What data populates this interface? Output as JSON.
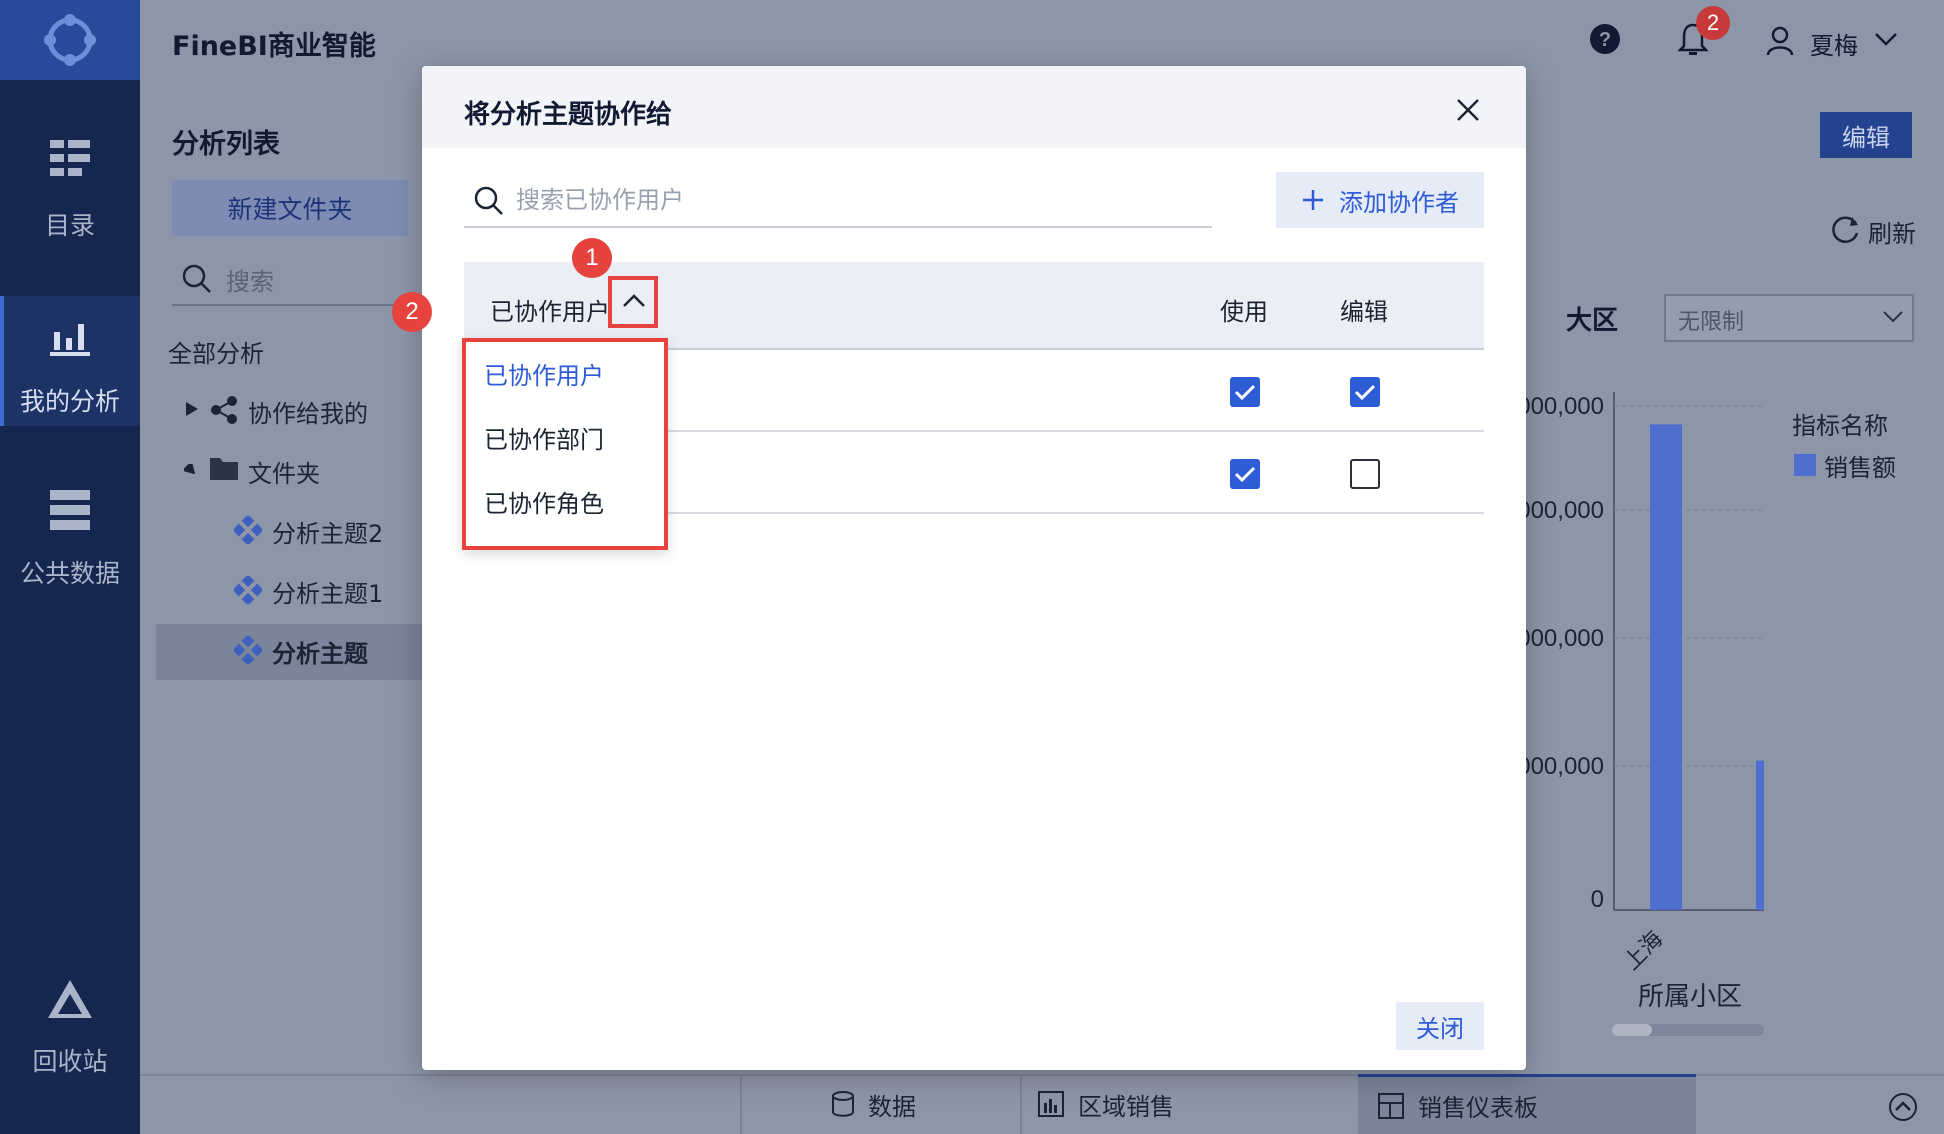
{
  "app": {
    "title": "FineBI商业智能",
    "user_name": "夏梅",
    "notification_count": "2"
  },
  "nav": [
    {
      "label": "目录",
      "icon": "catalog-icon"
    },
    {
      "label": "我的分析",
      "icon": "analysis-icon"
    },
    {
      "label": "公共数据",
      "icon": "public-data-icon"
    },
    {
      "label": "回收站",
      "icon": "recycle-icon"
    }
  ],
  "list": {
    "title": "分析列表",
    "new_folder": "新建文件夹",
    "search_placeholder": "搜索",
    "tree": [
      "全部分析",
      "协作给我的",
      "文件夹",
      "分析主题2",
      "分析主题1",
      "分析主题"
    ]
  },
  "right": {
    "edit": "编辑",
    "refresh": "刷新",
    "filter_label": "大区",
    "filter_value": "无限制"
  },
  "chart_data": {
    "type": "bar",
    "categories": [
      "上海",
      ""
    ],
    "values": [
      3900000,
      1200000
    ],
    "xlabel": "所属小区",
    "y_tick_labels": [
      "000,000",
      "000,000",
      "000,000",
      "000,000",
      "0"
    ],
    "legend_title": "指标名称",
    "series": [
      {
        "name": "销售额",
        "values": [
          3900000,
          1200000
        ]
      }
    ],
    "color": "#4f6fd0"
  },
  "modal": {
    "title": "将分析主题协作给",
    "search_placeholder": "搜索已协作用户",
    "add_button": "添加协作者",
    "column_user": "已协作用户",
    "column_use": "使用",
    "column_edit": "编辑",
    "rows": [
      {
        "use": true,
        "edit": true
      },
      {
        "use": true,
        "edit": false
      }
    ],
    "dropdown": [
      "已协作用户",
      "已协作部门",
      "已协作角色"
    ],
    "close_button": "关闭"
  },
  "badges": [
    "1",
    "2"
  ],
  "bottom_tabs": [
    "数据",
    "区域销售",
    "销售仪表板"
  ]
}
